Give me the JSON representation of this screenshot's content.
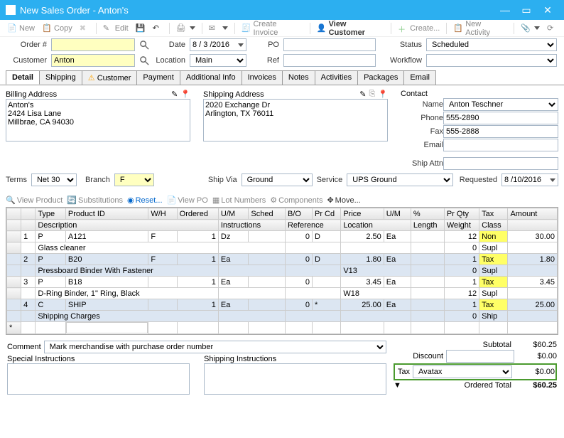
{
  "window": {
    "title": "New Sales Order - Anton's"
  },
  "toolbar": {
    "new": "New",
    "copy": "Copy",
    "edit": "Edit",
    "create_invoice": "Create Invoice",
    "view_customer": "View Customer",
    "create": "Create...",
    "new_activity": "New Activity"
  },
  "header": {
    "order_label": "Order #",
    "order": "",
    "date_label": "Date",
    "date": "8 / 3 /2016",
    "po_label": "PO",
    "po": "",
    "status_label": "Status",
    "status": "Scheduled",
    "customer_label": "Customer",
    "customer": "Anton",
    "location_label": "Location",
    "location": "Main",
    "ref_label": "Ref",
    "ref": "",
    "workflow_label": "Workflow",
    "workflow": ""
  },
  "tabs": [
    "Detail",
    "Shipping",
    "Customer",
    "Payment",
    "Additional Info",
    "Invoices",
    "Notes",
    "Activities",
    "Packages",
    "Email"
  ],
  "billing": {
    "label": "Billing Address",
    "text": "Anton's\n2424 Lisa Lane\nMillbrae, CA 94030"
  },
  "shipping": {
    "label": "Shipping Address",
    "text": "2020 Exchange Dr\nArlington, TX 76011"
  },
  "contact": {
    "label": "Contact",
    "name_label": "Name",
    "name": "Anton Teschner",
    "phone_label": "Phone",
    "phone": "555-2890",
    "fax_label": "Fax",
    "fax": "555-2888",
    "email_label": "Email",
    "email": "",
    "shipattn_label": "Ship Attn",
    "shipattn": ""
  },
  "row2": {
    "terms_label": "Terms",
    "terms": "Net 30",
    "branch_label": "Branch",
    "branch": "F",
    "shipvia_label": "Ship Via",
    "shipvia": "Ground",
    "service_label": "Service",
    "service": "UPS Ground",
    "requested_label": "Requested",
    "requested": "8 /10/2016"
  },
  "smalltb": {
    "view_product": "View Product",
    "subs": "Substitutions",
    "reset": "Reset...",
    "view_po": "View PO",
    "lot": "Lot Numbers",
    "components": "Components",
    "move": "Move..."
  },
  "cols1": [
    "",
    "",
    "Type",
    "Product ID",
    "W/H",
    "Ordered",
    "U/M",
    "Sched",
    "B/O",
    "Pr Cd",
    "Price",
    "U/M",
    "%",
    "Pr Qty",
    "Tax",
    "Amount"
  ],
  "cols2": [
    "",
    "",
    "Description",
    "",
    "",
    "",
    "Instructions",
    "",
    "Reference",
    "",
    "Location",
    "",
    "Length",
    "Weight",
    "Class",
    ""
  ],
  "lines": [
    {
      "n": "1",
      "type": "P",
      "pid": "A121",
      "wh": "F",
      "ord": "1",
      "um": "Dz",
      "sched": "",
      "bo": "0",
      "prcd": "D",
      "price": "2.50",
      "um2": "Ea",
      "pct": "",
      "prqty": "12",
      "tax": "Non",
      "amt": "30.00",
      "desc": "Glass cleaner",
      "loc": "",
      "wt": "0",
      "cls": "Supl"
    },
    {
      "n": "2",
      "type": "P",
      "pid": "B20",
      "wh": "F",
      "ord": "1",
      "um": "Ea",
      "sched": "",
      "bo": "0",
      "prcd": "D",
      "price": "1.80",
      "um2": "Ea",
      "pct": "",
      "prqty": "1",
      "tax": "Tax",
      "amt": "1.80",
      "desc": "Pressboard Binder With Fastener",
      "loc": "V13",
      "wt": "0",
      "cls": "Supl"
    },
    {
      "n": "3",
      "type": "P",
      "pid": "B18",
      "wh": "",
      "ord": "1",
      "um": "Ea",
      "sched": "",
      "bo": "0",
      "prcd": "",
      "price": "3.45",
      "um2": "Ea",
      "pct": "",
      "prqty": "1",
      "tax": "Tax",
      "amt": "3.45",
      "desc": "D-Ring Binder, 1\" Ring, Black",
      "loc": "W18",
      "wt": "12",
      "cls": "Supl"
    },
    {
      "n": "4",
      "type": "C",
      "pid": "SHIP",
      "wh": "",
      "ord": "1",
      "um": "Ea",
      "sched": "",
      "bo": "0",
      "prcd": "*",
      "price": "25.00",
      "um2": "Ea",
      "pct": "",
      "prqty": "1",
      "tax": "Tax",
      "amt": "25.00",
      "desc": "Shipping Charges",
      "loc": "",
      "wt": "0",
      "cls": "Ship"
    }
  ],
  "comment_label": "Comment",
  "comment": "Mark merchandise with purchase order number",
  "special_label": "Special Instructions",
  "shipinstr_label": "Shipping Instructions",
  "totals": {
    "subtotal_label": "Subtotal",
    "subtotal": "$60.25",
    "discount_label": "Discount",
    "discount": "$0.00",
    "tax_label": "Tax",
    "tax_scheme": "Avatax",
    "tax": "$0.00",
    "ordered_label": "Ordered Total",
    "ordered": "$60.25",
    "expander": "▼"
  }
}
